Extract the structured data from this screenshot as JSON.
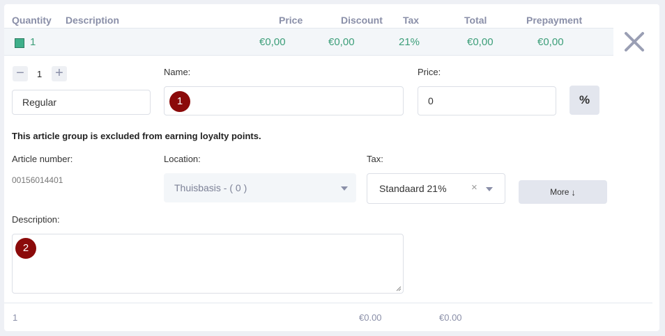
{
  "table_header": {
    "quantity": "Quantity",
    "description": "Description",
    "price": "Price",
    "discount": "Discount",
    "tax": "Tax",
    "total": "Total",
    "prepayment": "Prepayment"
  },
  "summary_row": {
    "quantity": "1",
    "price": "€0,00",
    "discount": "€0,00",
    "tax": "21%",
    "total": "€0,00",
    "prepayment": "€0,00",
    "swatch_color": "#3faf8a"
  },
  "editor": {
    "stepper": {
      "minus": "−",
      "value": "1",
      "plus": "+"
    },
    "type_field": {
      "value": "Regular"
    },
    "name_label": "Name:",
    "name_field": {
      "value": ""
    },
    "price_label": "Price:",
    "price_field": {
      "value": "0"
    },
    "percent_button": "%",
    "loyalty_note": "This article group is excluded from earning loyalty points.",
    "article_number_label": "Article number:",
    "article_number_value": "00156014401",
    "location_label": "Location:",
    "location_select": {
      "value": "Thuisbasis - ( 0 )"
    },
    "tax_label": "Tax:",
    "tax_select": {
      "value": "Standaard 21%",
      "clear": "×"
    },
    "more_button": "More",
    "more_icon": "↓",
    "description_label": "Description:",
    "description_field": {
      "value": ""
    }
  },
  "badges": {
    "first": "1",
    "second": "2"
  },
  "footer": {
    "quantity": "1",
    "value_a": "€0.00",
    "value_b": "€0.00"
  }
}
